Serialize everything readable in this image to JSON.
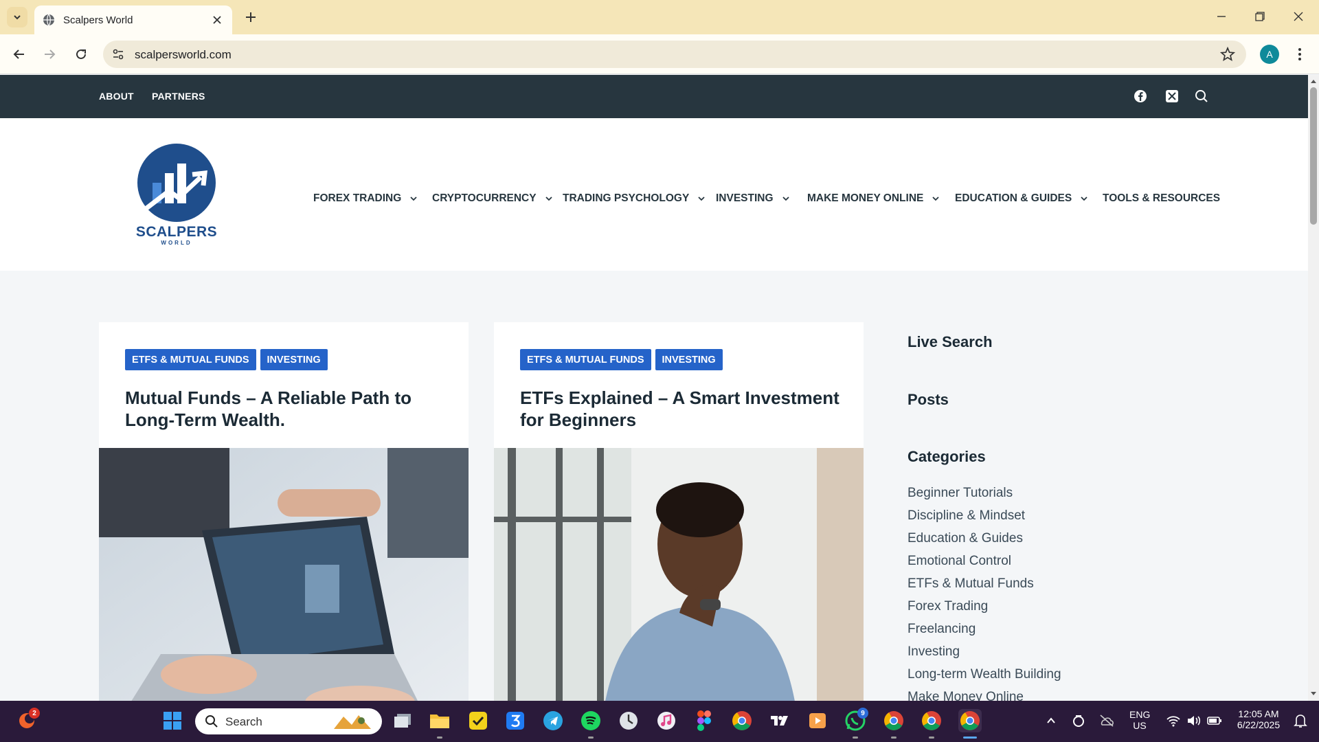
{
  "browser": {
    "tab_title": "Scalpers World",
    "url": "scalpersworld.com",
    "profile_initial": "A"
  },
  "site": {
    "top_links": [
      "ABOUT",
      "PARTNERS"
    ],
    "brand": "SCALPERS",
    "brand_sub": "WORLD",
    "nav": [
      {
        "label": "FOREX TRADING",
        "has_menu": true
      },
      {
        "label": "CRYPTOCURRENCY",
        "has_menu": true
      },
      {
        "label": "TRADING PSYCHOLOGY",
        "has_menu": true
      },
      {
        "label": "INVESTING",
        "has_menu": true
      },
      {
        "label": "MAKE MONEY ONLINE",
        "has_menu": true
      },
      {
        "label": "EDUCATION & GUIDES",
        "has_menu": true
      },
      {
        "label": "TOOLS & RESOURCES",
        "has_menu": false
      }
    ],
    "accent": "#2563c9",
    "dark": "#27363f"
  },
  "posts": [
    {
      "tags": [
        "ETFS & MUTUAL FUNDS",
        "INVESTING"
      ],
      "title": "Mutual Funds – A Reliable Path to Long-Term Wealth."
    },
    {
      "tags": [
        "ETFS & MUTUAL FUNDS",
        "INVESTING"
      ],
      "title": "ETFs Explained – A Smart Investment for Beginners"
    }
  ],
  "sidebar": {
    "live_search": "Live Search",
    "posts": "Posts",
    "categories_title": "Categories",
    "categories": [
      "Beginner Tutorials",
      "Discipline & Mindset",
      "Education & Guides",
      "Emotional Control",
      "ETFs & Mutual Funds",
      "Forex Trading",
      "Freelancing",
      "Investing",
      "Long-term Wealth Building",
      "Make Money Online"
    ]
  },
  "taskbar": {
    "search_label": "Search",
    "badge_left": "2",
    "whatsapp_badge": "9",
    "lang": "ENG",
    "region": "US",
    "time": "12:05 AM",
    "date": "6/22/2025"
  }
}
